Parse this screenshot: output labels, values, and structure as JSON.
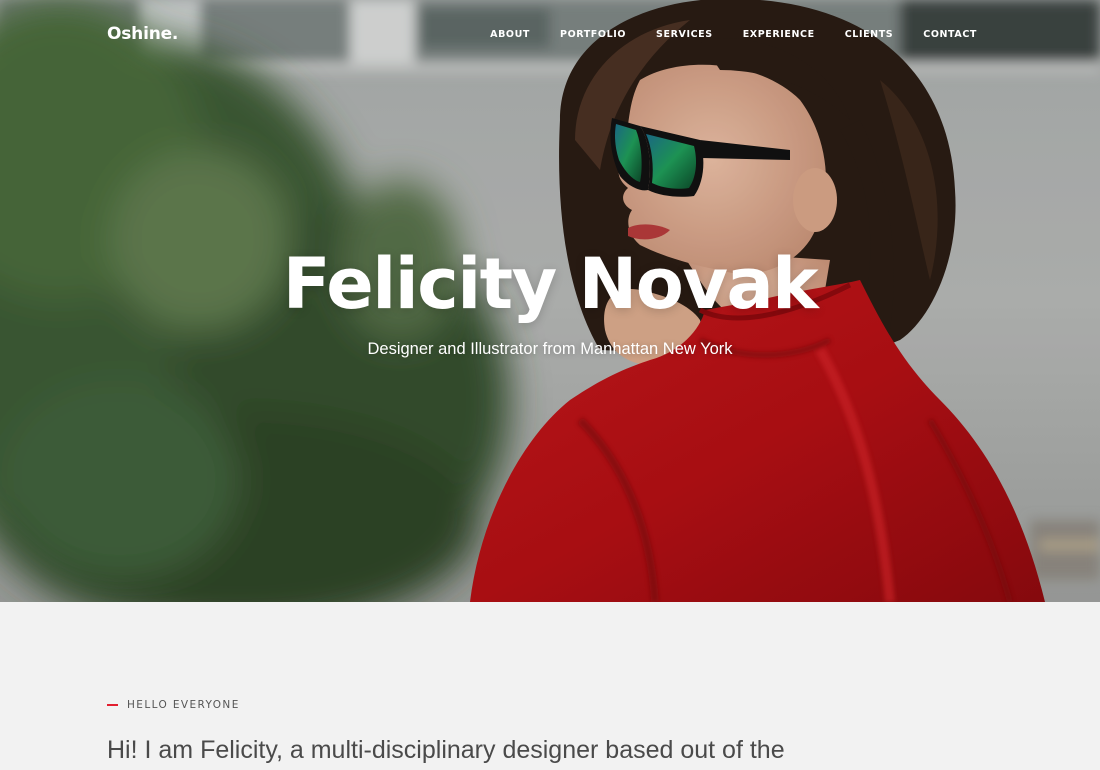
{
  "brand": {
    "logo": "Oshine."
  },
  "nav": {
    "items": [
      {
        "label": "ABOUT"
      },
      {
        "label": "PORTFOLIO"
      },
      {
        "label": "SERVICES"
      },
      {
        "label": "EXPERIENCE"
      },
      {
        "label": "CLIENTS"
      },
      {
        "label": "CONTACT"
      }
    ]
  },
  "hero": {
    "title": "Felicity Novak",
    "subtitle": "Designer and Illustrator from Manhattan New York",
    "photo": "woman-red-jacket-sunglasses-photo"
  },
  "about": {
    "eyebrow": "HELLO EVERYONE",
    "intro": "Hi! I am Felicity, a multi-disciplinary designer based out of the"
  },
  "colors": {
    "accent": "#e21f30",
    "jacket": "#b50f14",
    "section_bg": "#f2f2f2",
    "text_dark": "#4a4a4a"
  }
}
